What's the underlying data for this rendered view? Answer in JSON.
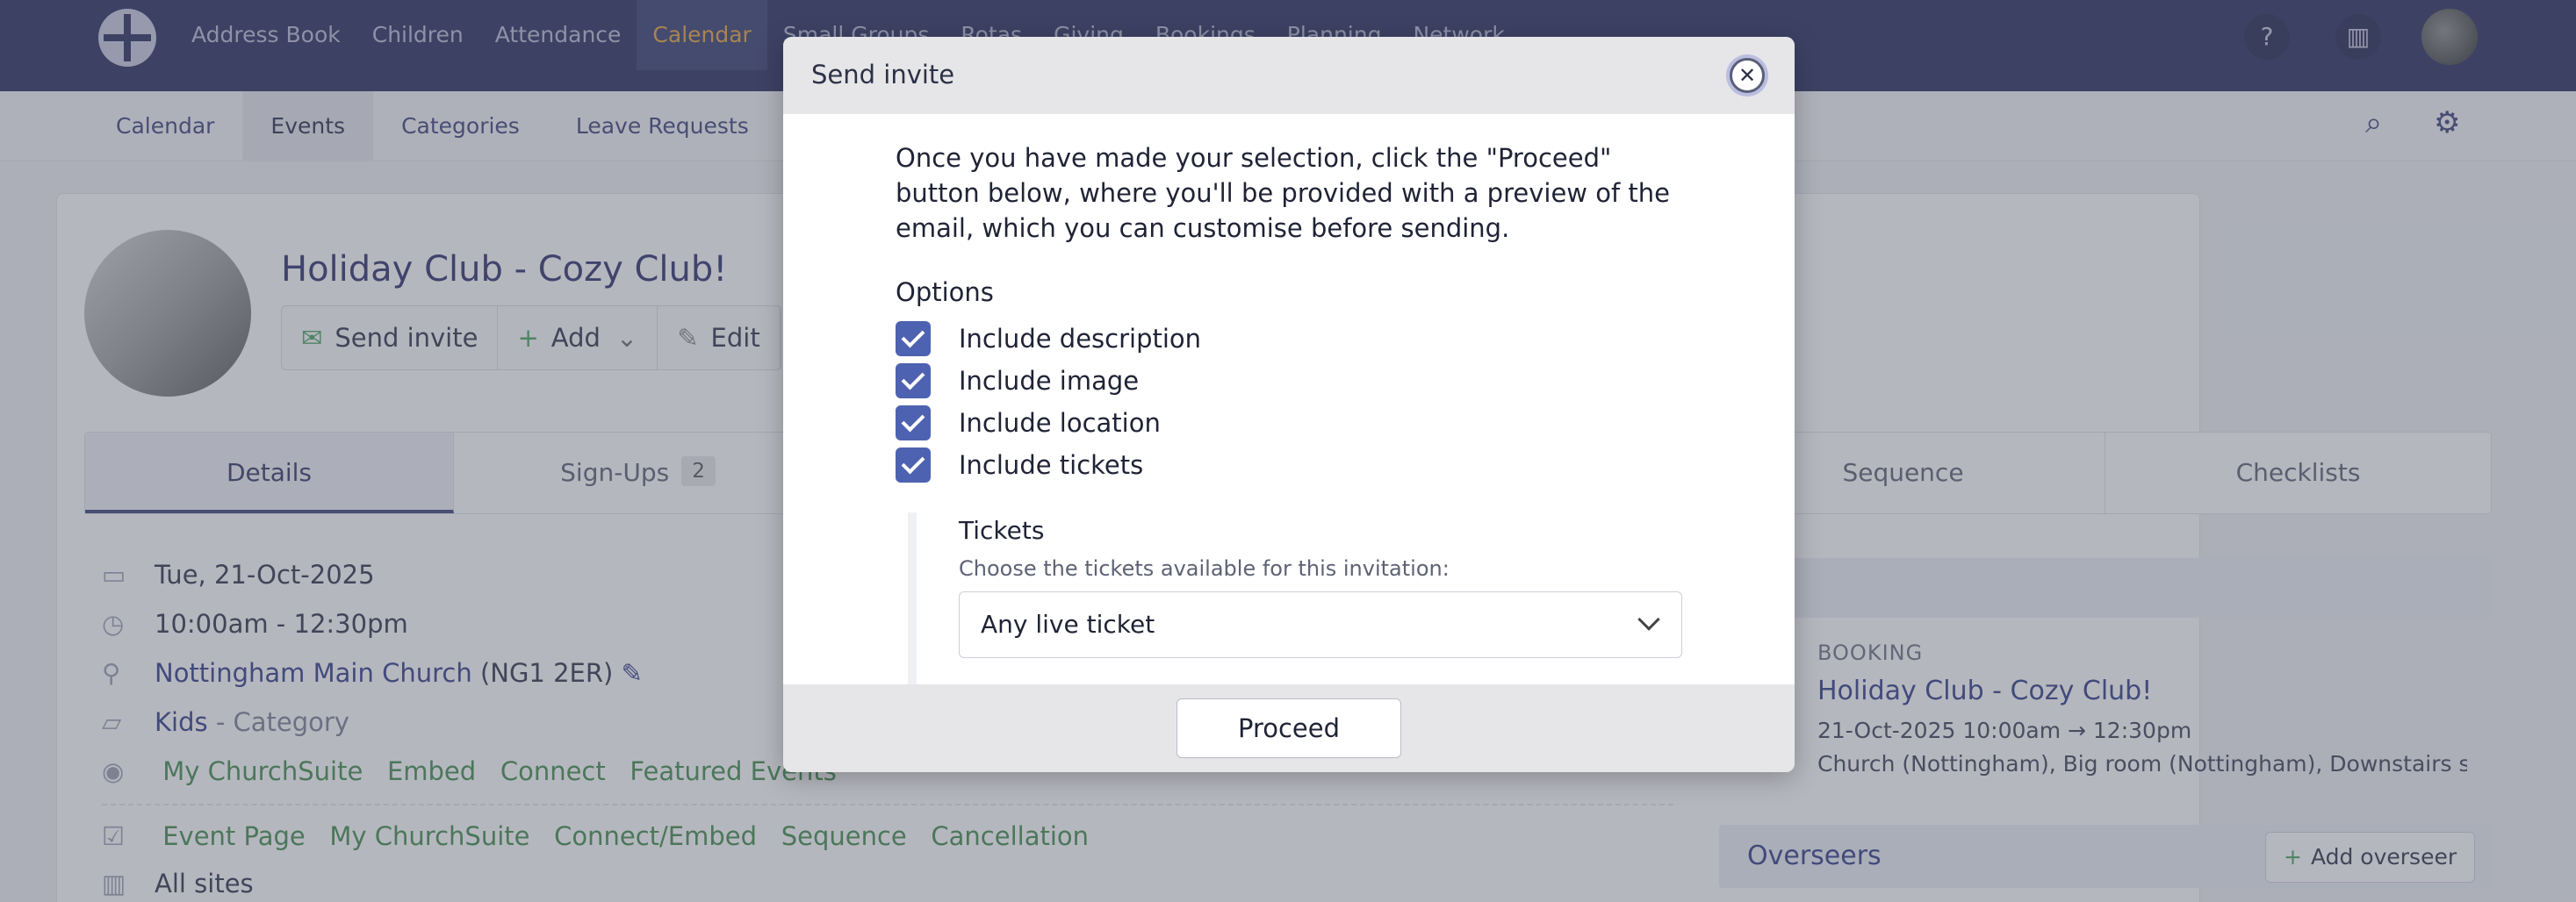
{
  "topnav": {
    "items": [
      "Address Book",
      "Children",
      "Attendance",
      "Calendar",
      "Small Groups",
      "Rotas",
      "Giving",
      "Bookings",
      "Planning",
      "Network"
    ],
    "active": "Calendar"
  },
  "subnav": {
    "items": [
      "Calendar",
      "Events",
      "Categories",
      "Leave Requests",
      "Le"
    ],
    "active": "Events"
  },
  "event": {
    "title": "Holiday Club - Cozy Club!",
    "actions": [
      "Send invite",
      "Add",
      "Edit"
    ],
    "tabs": [
      {
        "label": "Details"
      },
      {
        "label": "Sign-Ups",
        "count": "2"
      }
    ],
    "tabs_right": [
      "Sequence",
      "Checklists"
    ],
    "date": "Tue, 21-Oct-2025",
    "time": "10:00am - 12:30pm",
    "location_link": "Nottingham Main Church",
    "location_postcode": "(NG1 2ER)",
    "category_link": "Kids",
    "category_suffix": "- Category",
    "visibility": [
      "My ChurchSuite",
      "Embed",
      "Connect",
      "Featured Events"
    ],
    "pages": [
      "Event Page",
      "My ChurchSuite",
      "Connect/Embed",
      "Sequence",
      "Cancellation"
    ],
    "sites": "All sites"
  },
  "right_panel": {
    "header_fragment": "s",
    "booking_label": "BOOKING",
    "booking_title": "Holiday Club - Cozy Club!",
    "booking_time": "21-Oct-2025 10:00am → 12:30pm",
    "booking_location": "Church (Nottingham), Big room (Nottingham), Downstairs snug (No",
    "overseers_label": "Overseers",
    "add_overseer": "Add overseer"
  },
  "modal": {
    "title": "Send invite",
    "intro": "Once you have made your selection, click the \"Proceed\" button below, where you'll be provided with a preview of the email, which you can customise before sending.",
    "options_label": "Options",
    "options": [
      {
        "label": "Include description",
        "checked": true
      },
      {
        "label": "Include image",
        "checked": true
      },
      {
        "label": "Include location",
        "checked": true
      },
      {
        "label": "Include tickets",
        "checked": true
      }
    ],
    "tickets_label": "Tickets",
    "tickets_help": "Choose the tickets available for this invitation:",
    "tickets_value": "Any live ticket",
    "proceed": "Proceed"
  },
  "icons": {
    "help": "question-circle-icon",
    "sites": "building-icon",
    "search": "search-icon",
    "settings": "gear-icon",
    "close": "close-icon"
  },
  "colors": {
    "nav_bg": "#262a5c",
    "accent": "#e8a33a",
    "checkbox": "#4d62b0",
    "link": "#2f3a86",
    "green_link": "#3e8a4a"
  }
}
